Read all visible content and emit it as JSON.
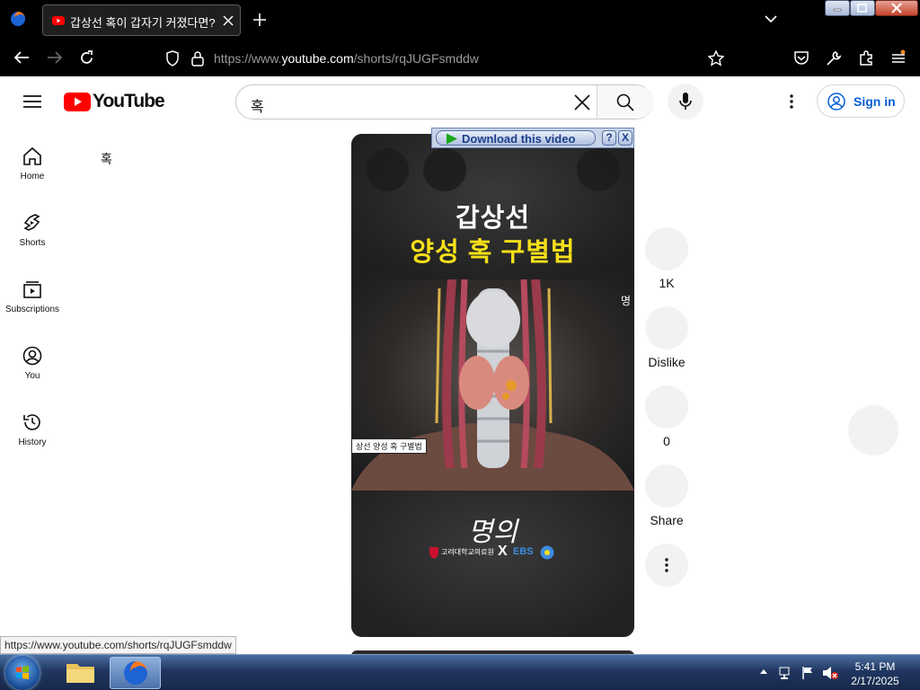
{
  "browser": {
    "tab": {
      "title": "갑상선 혹이 갑자기 커졌다면? -"
    },
    "url": {
      "prefix": "https://www.",
      "domain": "youtube.com",
      "path": "/shorts/rqJUGFsmddw"
    }
  },
  "youtube": {
    "logo_text": "YouTube",
    "search": {
      "value": "혹"
    },
    "signin_label": "Sign in",
    "sidebar": {
      "items": [
        {
          "label": "Home",
          "icon": "home-icon"
        },
        {
          "label": "Shorts",
          "icon": "shorts-icon"
        },
        {
          "label": "Subscriptions",
          "icon": "subscriptions-icon"
        },
        {
          "label": "You",
          "icon": "you-icon"
        },
        {
          "label": "History",
          "icon": "history-icon"
        }
      ]
    },
    "chip_text": "혹",
    "video": {
      "title_line1": "갑상선",
      "title_line2": "양성 혹 구별법",
      "caption_tag": "상선 양성 혹 구별법",
      "brand_text": "명의",
      "partner_left": "고려대학교의료원",
      "partner_x": "X",
      "partner_right": "EBS"
    },
    "actions": {
      "like_count": "1K",
      "dislike_label": "Dislike",
      "comments_count": "0",
      "share_label": "Share"
    },
    "download_bar": {
      "label": "Download this video",
      "help": "?",
      "close": "X"
    }
  },
  "status_url": "https://www.youtube.com/shorts/rqJUGFsmddw",
  "taskbar": {
    "time": "5:41 PM",
    "date": "2/17/2025"
  },
  "colors": {
    "youtube_red": "#ff0000",
    "link_blue": "#065fd4",
    "title_yellow": "#f5df1a"
  }
}
